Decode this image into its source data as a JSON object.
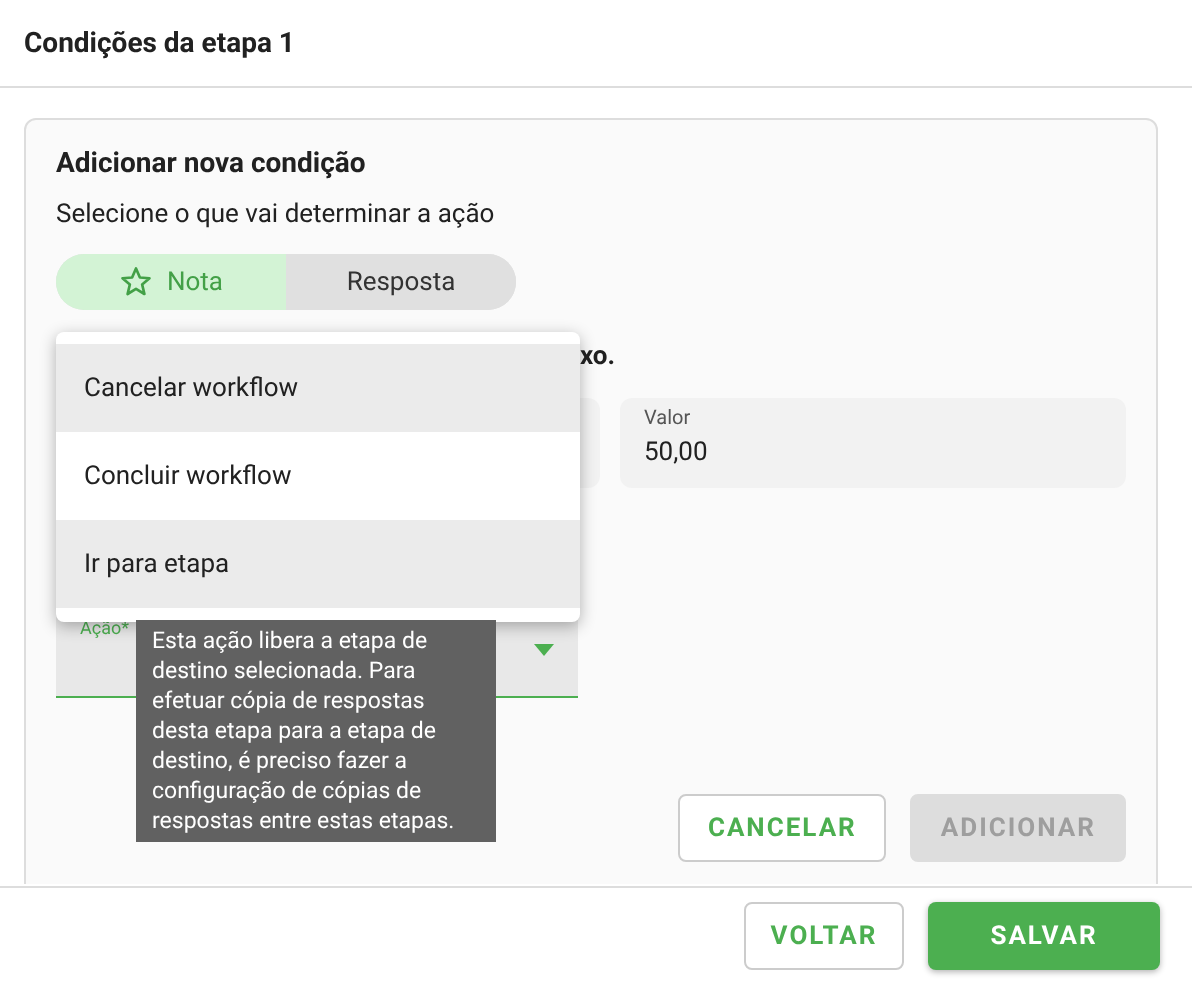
{
  "dialog": {
    "title": "Condições da etapa 1"
  },
  "card": {
    "title": "Adicionar nova condição",
    "subtitle": "Selecione o que vai determinar a ação",
    "toggle": [
      {
        "label": "Nota",
        "selected": true,
        "icon": true
      },
      {
        "label": "Resposta",
        "selected": false,
        "icon": false
      }
    ],
    "hint_tail": "xo.",
    "value_field": {
      "label": "Valor",
      "value": "50,00"
    },
    "action_field": {
      "label": "Ação*"
    },
    "buttons": [
      {
        "label": "CANCELAR",
        "disabled": false
      },
      {
        "label": "ADICIONAR",
        "disabled": true
      }
    ]
  },
  "menu": {
    "items": [
      {
        "label": "Cancelar workflow",
        "highlighted": true
      },
      {
        "label": "Concluir workflow",
        "highlighted": false
      },
      {
        "label": "Ir para etapa",
        "highlighted": true
      }
    ]
  },
  "tooltip": "Esta ação libera a etapa de destino selecionada. Para efetuar cópia de respostas desta etapa para a etapa de destino, é preciso fazer a configuração de cópias de respostas entre estas etapas.",
  "footer": {
    "buttons": [
      {
        "label": "VOLTAR",
        "kind": "outline"
      },
      {
        "label": "SALVAR",
        "kind": "primary"
      }
    ]
  }
}
